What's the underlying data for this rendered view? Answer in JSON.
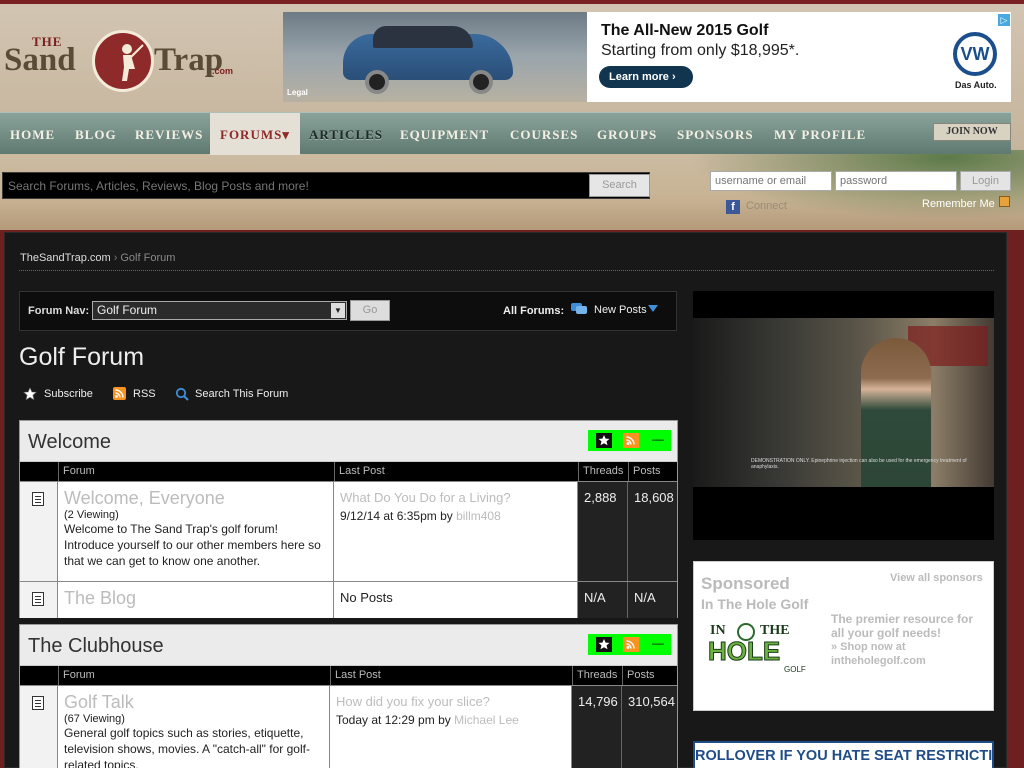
{
  "header": {
    "logo": {
      "the": "THE",
      "sand": "Sand",
      "trap": "Trap",
      "com": ".com"
    },
    "ad": {
      "legal": "Legal",
      "headline": "The All-New 2015 Golf",
      "subline": "Starting from only $18,995*.",
      "cta": "Learn more  ›",
      "brand_mark": "VW",
      "brand_tagline": "Das Auto.",
      "adchoices": "▷"
    },
    "nav": {
      "items": [
        "HOME",
        "BLOG",
        "REVIEWS",
        "FORUMS▾",
        "ARTICLES",
        "EQUIPMENT",
        "COURSES",
        "GROUPS",
        "SPONSORS",
        "MY PROFILE"
      ],
      "join": "JOIN NOW"
    },
    "search": {
      "placeholder": "Search Forums, Articles, Reviews, Blog Posts and more!",
      "button": "Search"
    },
    "login": {
      "username_placeholder": "username or email",
      "password_placeholder": "password",
      "button": "Login",
      "connect": "Connect",
      "remember": "Remember Me"
    }
  },
  "breadcrumb": {
    "home": "TheSandTrap.com",
    "sep": "›",
    "current": "Golf Forum"
  },
  "forum_nav": {
    "label": "Forum Nav:",
    "selected": "Golf Forum",
    "go": "Go",
    "all_forums": "All Forums:",
    "new_posts": "New Posts"
  },
  "page_title": "Golf Forum",
  "tools": {
    "subscribe": "Subscribe",
    "rss": "RSS",
    "search": "Search This Forum"
  },
  "categories": [
    {
      "title": "Welcome",
      "headers": {
        "forum": "Forum",
        "last_post": "Last Post",
        "threads": "Threads",
        "posts": "Posts"
      },
      "rows": [
        {
          "name": "Welcome, Everyone",
          "viewing": "(2 Viewing)",
          "desc": "Welcome to The Sand Trap's golf forum! Introduce yourself to our other members here so that we can get to know one another.",
          "last_title": "What Do You Do for a Living?",
          "last_when": "9/12/14 at 6:35pm by",
          "last_user": "billm408",
          "threads": "2,888",
          "posts": "18,608"
        },
        {
          "name": "The Blog",
          "last_text": "No Posts",
          "threads": "N/A",
          "posts": "N/A"
        }
      ]
    },
    {
      "title": "The Clubhouse",
      "headers": {
        "forum": "Forum",
        "last_post": "Last Post",
        "threads": "Threads",
        "posts": "Posts"
      },
      "rows": [
        {
          "name": "Golf Talk",
          "viewing": "(67 Viewing)",
          "desc": "General golf topics such as stories, etiquette, television shows, movies. A \"catch-all\" for golf-related topics.",
          "last_title": "How did you fix your slice?",
          "last_when": "Today at 12:29 pm by",
          "last_user": "Michael Lee",
          "threads": "14,796",
          "posts": "310,564"
        }
      ]
    }
  ],
  "sidebar": {
    "video_caption": "DEMONSTRATION ONLY. Epinephrine injection can also be used for the emergency treatment of anaphylaxis.",
    "sponsored": {
      "heading": "Sponsored",
      "view_all": "View all sponsors",
      "name": "In The Hole Golf",
      "logo_text": {
        "in": "IN",
        "the": "THE",
        "hole": "HOLE",
        "golf": "GOLF"
      },
      "desc": "The premier resource for all your golf needs!",
      "shop": "» Shop now at intheholegolf.com"
    },
    "banner": "ROLLOVER IF YOU HATE SEAT RESTRICTIONS."
  },
  "colors": {
    "brand_red": "#8f2a2a",
    "nav_green": "#5f7a72",
    "link_grey": "#bcbcbc",
    "button_green": "#00ff00",
    "rss_orange": "#f7931e",
    "vw_blue": "#1b4e8d"
  },
  "icons": [
    "golfer-logo-icon",
    "adchoices-icon",
    "vw-logo-icon",
    "facebook-icon",
    "checkbox-icon",
    "new-posts-icon",
    "subscribe-star-icon",
    "rss-icon",
    "search-icon",
    "forum-document-icon",
    "collapse-icon"
  ]
}
